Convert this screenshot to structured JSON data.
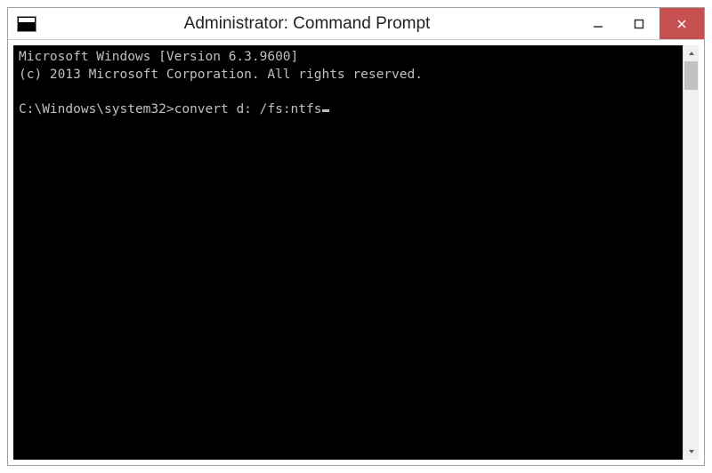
{
  "window": {
    "title": "Administrator: Command Prompt"
  },
  "console": {
    "line1": "Microsoft Windows [Version 6.3.9600]",
    "line2": "(c) 2013 Microsoft Corporation. All rights reserved.",
    "blank": "",
    "prompt": "C:\\Windows\\system32>",
    "command": "convert d: /fs:ntfs"
  }
}
